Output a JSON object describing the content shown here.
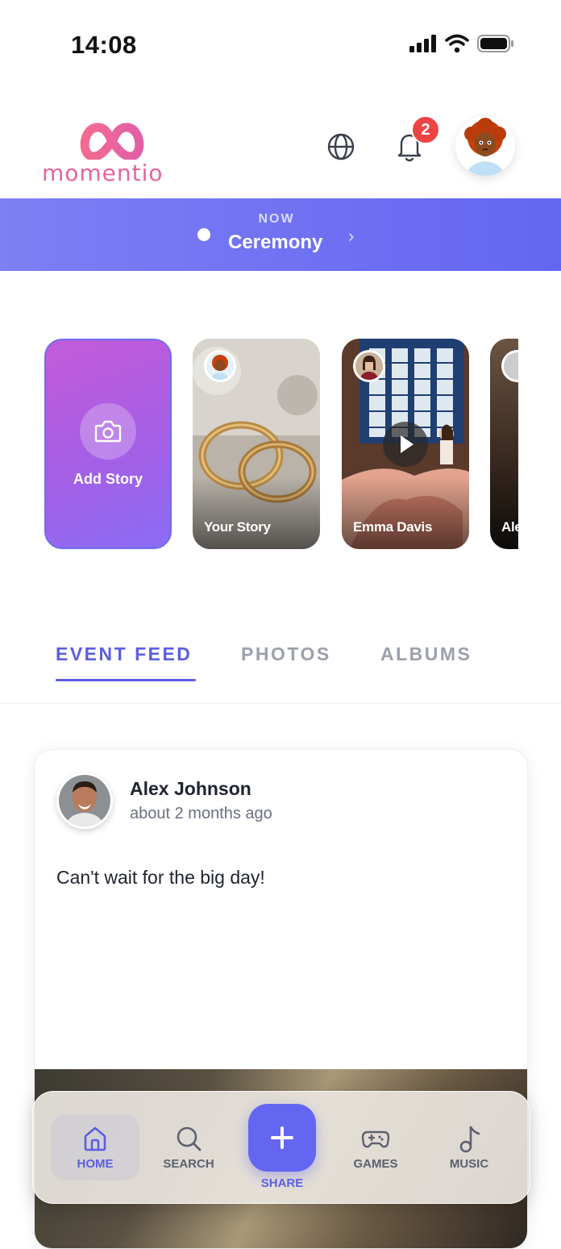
{
  "status_bar": {
    "time": "14:08"
  },
  "header": {
    "logo_text": "momentio",
    "notification_count": "2",
    "brand_color": "#e7649f"
  },
  "now_banner": {
    "label": "NOW",
    "title": "Ceremony",
    "accent": "#6366f1"
  },
  "stories": [
    {
      "label": "Add Story"
    },
    {
      "label": "Your Story"
    },
    {
      "label": "Emma Davis"
    },
    {
      "label": "Ale"
    }
  ],
  "tabs": [
    {
      "label": "EVENT FEED",
      "active": true
    },
    {
      "label": "PHOTOS",
      "active": false
    },
    {
      "label": "ALBUMS",
      "active": false
    }
  ],
  "post": {
    "author": "Alex Johnson",
    "time": "about 2 months ago",
    "text": "Can't wait for the big day!"
  },
  "bottom_nav": {
    "items": [
      {
        "label": "HOME",
        "icon": "home-icon",
        "active": true
      },
      {
        "label": "SEARCH",
        "icon": "search-icon",
        "active": false
      },
      {
        "label": "SHARE",
        "icon": "plus-icon",
        "active": false
      },
      {
        "label": "GAMES",
        "icon": "gamepad-icon",
        "active": false
      },
      {
        "label": "MUSIC",
        "icon": "music-note-icon",
        "active": false
      }
    ]
  }
}
